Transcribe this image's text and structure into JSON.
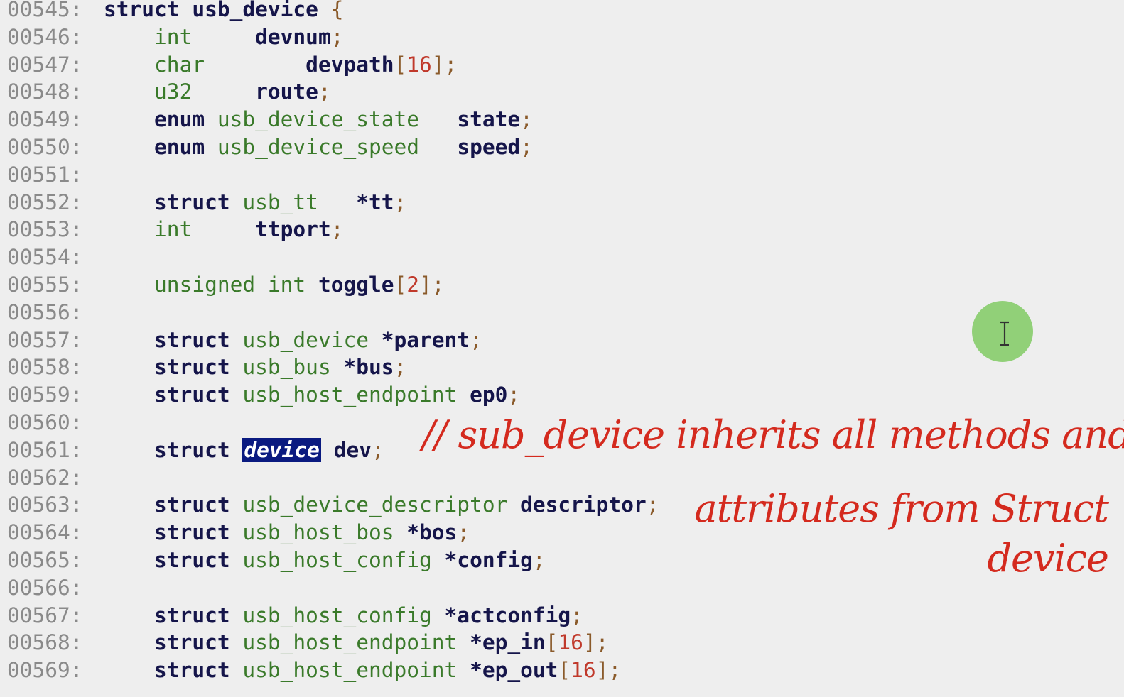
{
  "code": {
    "lines": [
      {
        "num": "00545:",
        "tokens": [
          {
            "t": "struct ",
            "c": "kw"
          },
          {
            "t": "usb_device",
            "c": "id"
          },
          {
            "t": " {",
            "c": "pu"
          }
        ]
      },
      {
        "num": "00546:",
        "tokens": [
          {
            "t": "    int     ",
            "c": "ty"
          },
          {
            "t": "devnum",
            "c": "id"
          },
          {
            "t": ";",
            "c": "pu"
          }
        ]
      },
      {
        "num": "00547:",
        "tokens": [
          {
            "t": "    char        ",
            "c": "ty"
          },
          {
            "t": "devpath",
            "c": "id"
          },
          {
            "t": "[",
            "c": "pu"
          },
          {
            "t": "16",
            "c": "nm"
          },
          {
            "t": "];",
            "c": "pu"
          }
        ]
      },
      {
        "num": "00548:",
        "tokens": [
          {
            "t": "    u32     ",
            "c": "ty"
          },
          {
            "t": "route",
            "c": "id"
          },
          {
            "t": ";",
            "c": "pu"
          }
        ]
      },
      {
        "num": "00549:",
        "tokens": [
          {
            "t": "    enum ",
            "c": "kw"
          },
          {
            "t": "usb_device_state   ",
            "c": "ty"
          },
          {
            "t": "state",
            "c": "id"
          },
          {
            "t": ";",
            "c": "pu"
          }
        ]
      },
      {
        "num": "00550:",
        "tokens": [
          {
            "t": "    enum ",
            "c": "kw"
          },
          {
            "t": "usb_device_speed   ",
            "c": "ty"
          },
          {
            "t": "speed",
            "c": "id"
          },
          {
            "t": ";",
            "c": "pu"
          }
        ]
      },
      {
        "num": "00551:",
        "tokens": []
      },
      {
        "num": "00552:",
        "tokens": [
          {
            "t": "    struct ",
            "c": "kw"
          },
          {
            "t": "usb_tt   ",
            "c": "ty"
          },
          {
            "t": "*tt",
            "c": "id"
          },
          {
            "t": ";",
            "c": "pu"
          }
        ]
      },
      {
        "num": "00553:",
        "tokens": [
          {
            "t": "    int     ",
            "c": "ty"
          },
          {
            "t": "ttport",
            "c": "id"
          },
          {
            "t": ";",
            "c": "pu"
          }
        ]
      },
      {
        "num": "00554:",
        "tokens": []
      },
      {
        "num": "00555:",
        "tokens": [
          {
            "t": "    unsigned int ",
            "c": "ty"
          },
          {
            "t": "toggle",
            "c": "id"
          },
          {
            "t": "[",
            "c": "pu"
          },
          {
            "t": "2",
            "c": "nm"
          },
          {
            "t": "];",
            "c": "pu"
          }
        ]
      },
      {
        "num": "00556:",
        "tokens": []
      },
      {
        "num": "00557:",
        "tokens": [
          {
            "t": "    struct ",
            "c": "kw"
          },
          {
            "t": "usb_device ",
            "c": "ty"
          },
          {
            "t": "*parent",
            "c": "id"
          },
          {
            "t": ";",
            "c": "pu"
          }
        ]
      },
      {
        "num": "00558:",
        "tokens": [
          {
            "t": "    struct ",
            "c": "kw"
          },
          {
            "t": "usb_bus ",
            "c": "ty"
          },
          {
            "t": "*bus",
            "c": "id"
          },
          {
            "t": ";",
            "c": "pu"
          }
        ]
      },
      {
        "num": "00559:",
        "tokens": [
          {
            "t": "    struct ",
            "c": "kw"
          },
          {
            "t": "usb_host_endpoint ",
            "c": "ty"
          },
          {
            "t": "ep0",
            "c": "id"
          },
          {
            "t": ";",
            "c": "pu"
          }
        ]
      },
      {
        "num": "00560:",
        "tokens": []
      },
      {
        "num": "00561:",
        "tokens": [
          {
            "t": "    struct ",
            "c": "kw"
          },
          {
            "t": "device",
            "c": "hl"
          },
          {
            "t": " dev",
            "c": "id"
          },
          {
            "t": ";",
            "c": "pu"
          }
        ]
      },
      {
        "num": "00562:",
        "tokens": []
      },
      {
        "num": "00563:",
        "tokens": [
          {
            "t": "    struct ",
            "c": "kw"
          },
          {
            "t": "usb_device_descriptor ",
            "c": "ty"
          },
          {
            "t": "descriptor",
            "c": "id"
          },
          {
            "t": ";",
            "c": "pu"
          }
        ]
      },
      {
        "num": "00564:",
        "tokens": [
          {
            "t": "    struct ",
            "c": "kw"
          },
          {
            "t": "usb_host_bos ",
            "c": "ty"
          },
          {
            "t": "*bos",
            "c": "id"
          },
          {
            "t": ";",
            "c": "pu"
          }
        ]
      },
      {
        "num": "00565:",
        "tokens": [
          {
            "t": "    struct ",
            "c": "kw"
          },
          {
            "t": "usb_host_config ",
            "c": "ty"
          },
          {
            "t": "*config",
            "c": "id"
          },
          {
            "t": ";",
            "c": "pu"
          }
        ]
      },
      {
        "num": "00566:",
        "tokens": []
      },
      {
        "num": "00567:",
        "tokens": [
          {
            "t": "    struct ",
            "c": "kw"
          },
          {
            "t": "usb_host_config ",
            "c": "ty"
          },
          {
            "t": "*actconfig",
            "c": "id"
          },
          {
            "t": ";",
            "c": "pu"
          }
        ]
      },
      {
        "num": "00568:",
        "tokens": [
          {
            "t": "    struct ",
            "c": "kw"
          },
          {
            "t": "usb_host_endpoint ",
            "c": "ty"
          },
          {
            "t": "*ep_in",
            "c": "id"
          },
          {
            "t": "[",
            "c": "pu"
          },
          {
            "t": "16",
            "c": "nm"
          },
          {
            "t": "];",
            "c": "pu"
          }
        ]
      },
      {
        "num": "00569:",
        "tokens": [
          {
            "t": "    struct ",
            "c": "kw"
          },
          {
            "t": "usb_host_endpoint ",
            "c": "ty"
          },
          {
            "t": "*ep_out",
            "c": "id"
          },
          {
            "t": "[",
            "c": "pu"
          },
          {
            "t": "16",
            "c": "nm"
          },
          {
            "t": "];",
            "c": "pu"
          }
        ]
      }
    ]
  },
  "annotation": {
    "line1": "// sub_device inherits all methods and",
    "line2": "attributes from Struct",
    "line3": "device",
    "color": "#d42a1e"
  },
  "cursor": {
    "icon": "text-cursor-ibeam-icon",
    "highlight_color": "#86cc6a"
  },
  "colors": {
    "background": "#eeeeee",
    "keyword": "#15154a",
    "type": "#3a7a2a",
    "number": "#c0392b",
    "line_number": "#8a8a8a",
    "selection": "#0a1a80"
  }
}
